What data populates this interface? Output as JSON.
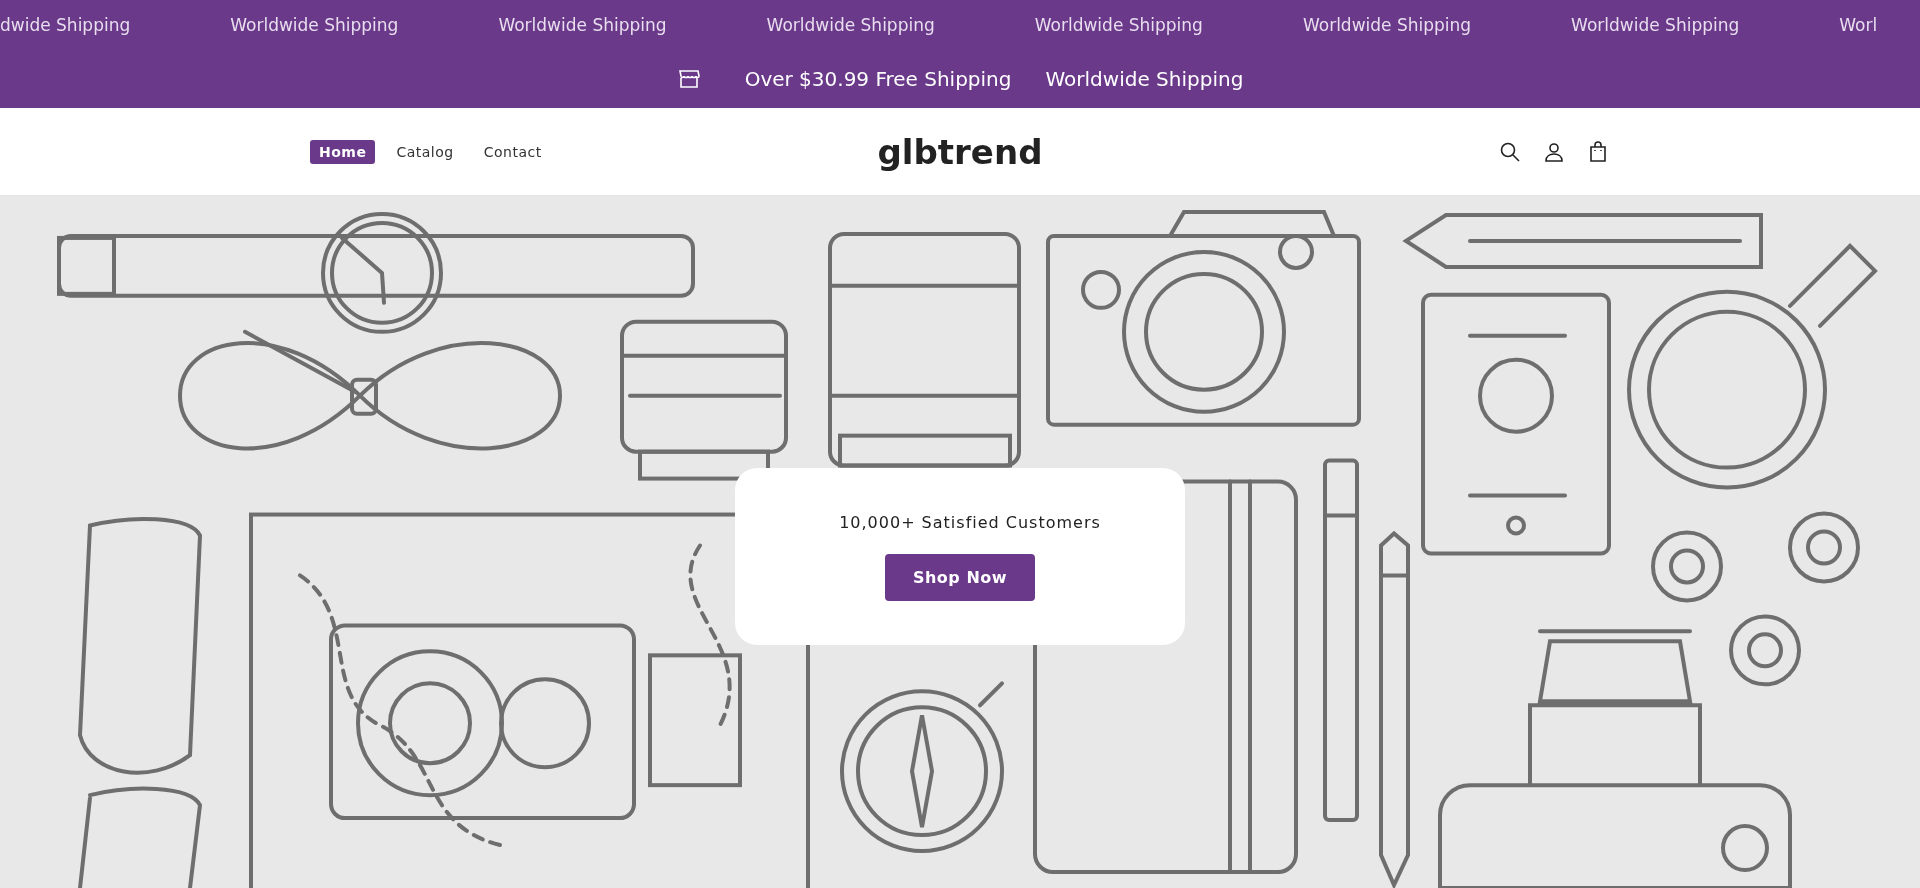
{
  "announcement": {
    "marquee": [
      "dwide Shipping",
      "Worldwide Shipping",
      "Worldwide Shipping",
      "Worldwide Shipping",
      "Worldwide Shipping",
      "Worldwide Shipping",
      "Worldwide Shipping",
      "Worl"
    ],
    "messages": [
      "Over $30.99 Free Shipping",
      "Worldwide Shipping"
    ]
  },
  "header": {
    "nav": [
      {
        "label": "Home",
        "selected": true
      },
      {
        "label": "Catalog",
        "selected": false
      },
      {
        "label": "Contact",
        "selected": false
      }
    ],
    "logo": "glbtrend"
  },
  "hero": {
    "text": "10,000+ Satisfied Customers",
    "button": "Shop Now"
  }
}
